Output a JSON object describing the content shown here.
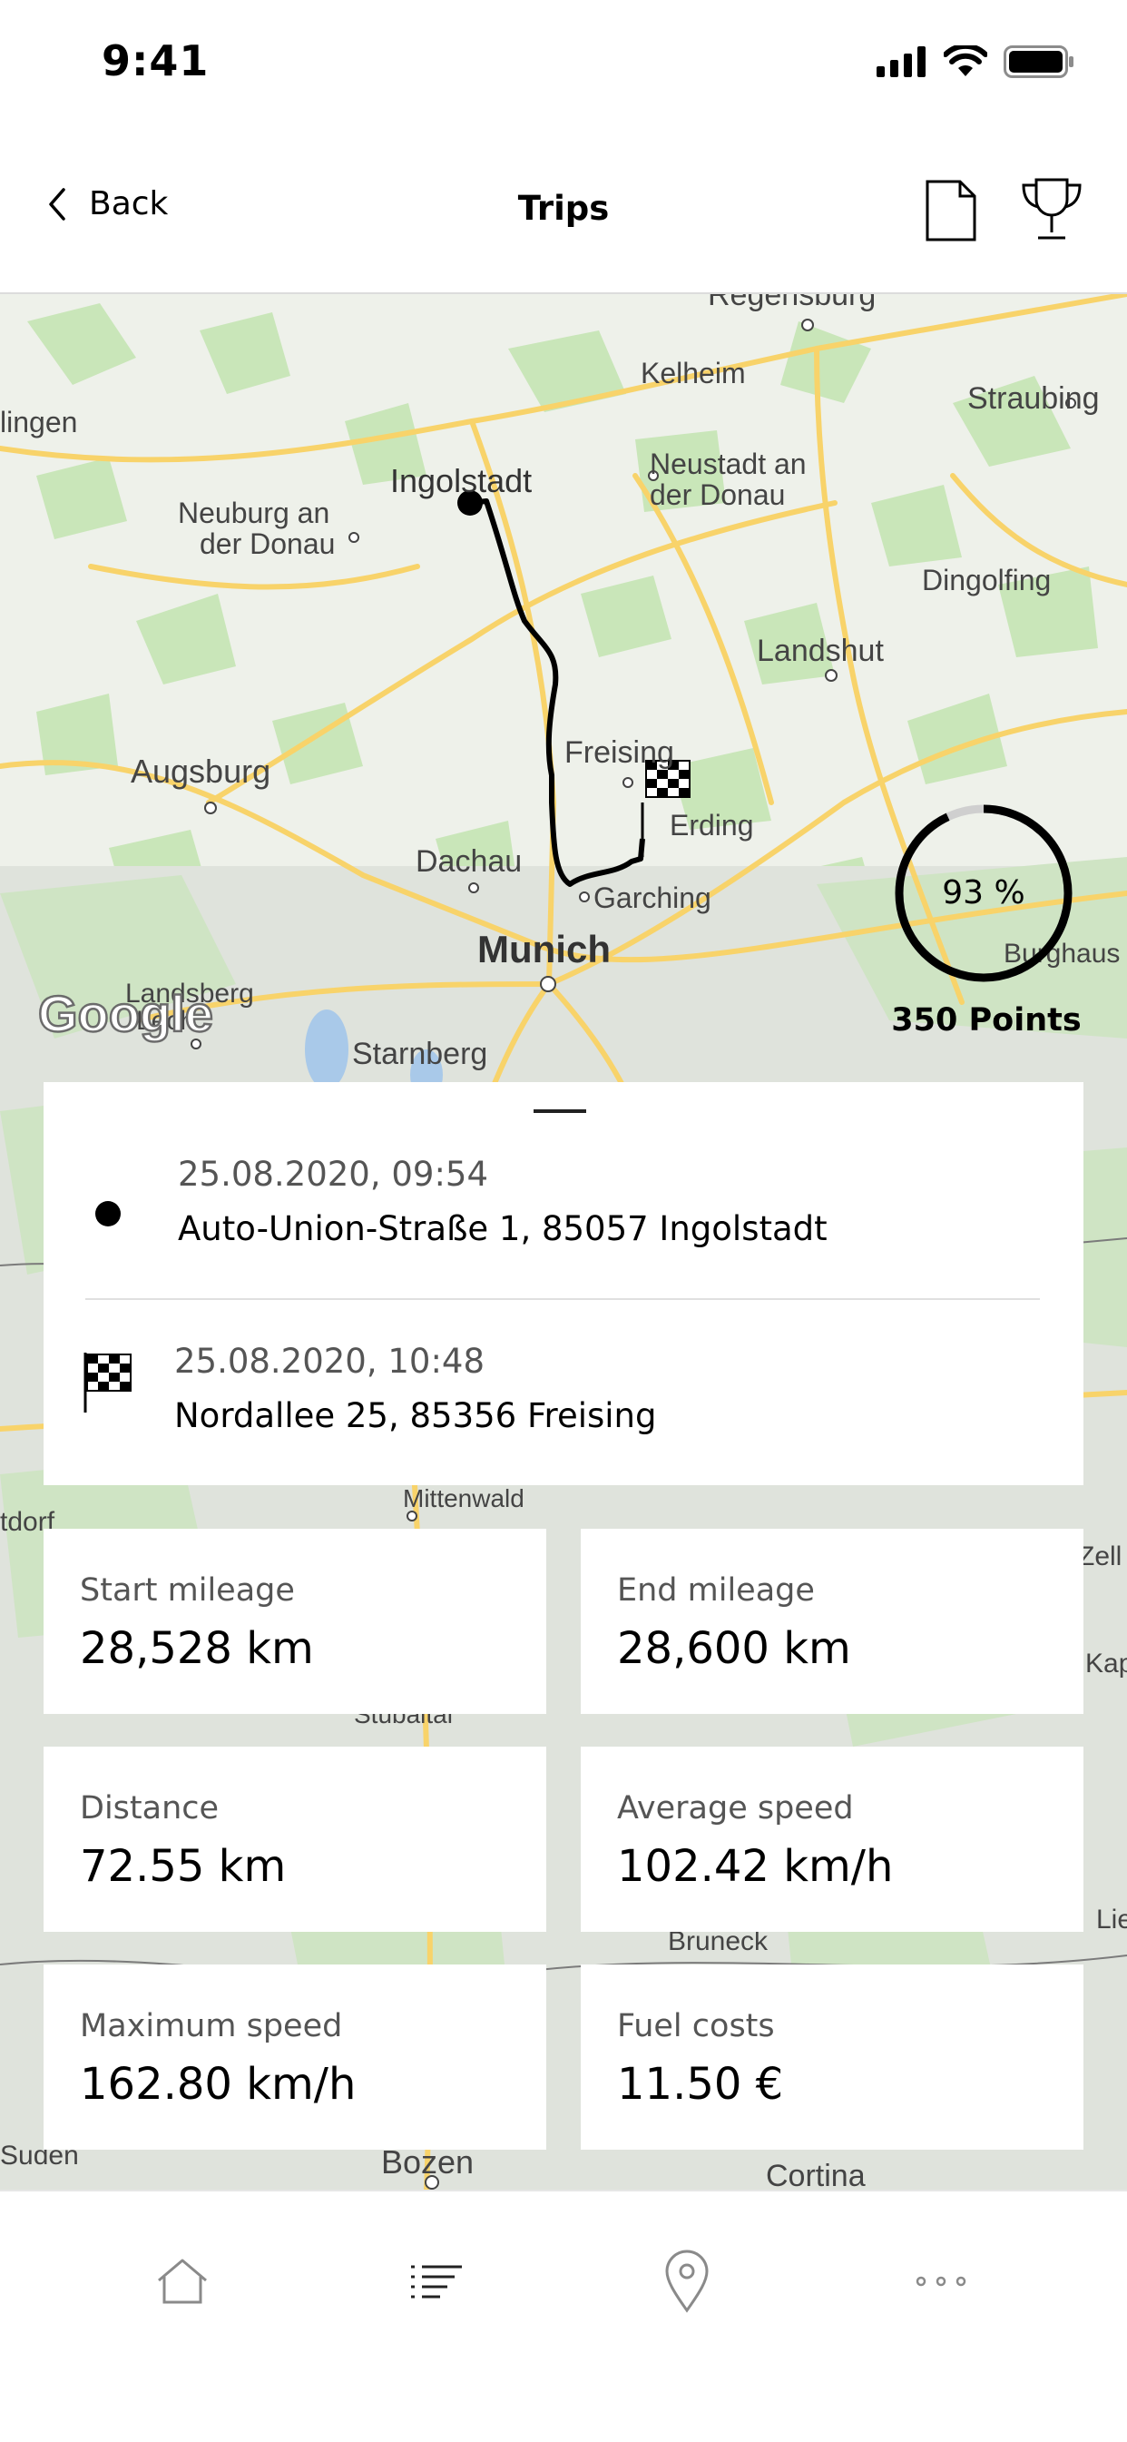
{
  "status_bar": {
    "time": "9:41"
  },
  "nav": {
    "back_label": "Back",
    "title": "Trips"
  },
  "map": {
    "labels": {
      "regensburg": "Regensburg",
      "kelheim": "Kelheim",
      "straubing": "Straubing",
      "ingolstadt": "Ingolstadt",
      "neustadt1": "Neustadt an",
      "neustadt2": "der Donau",
      "neuburg1": "Neuburg an",
      "neuburg2": "der Donau",
      "dingolfing": "Dingolfing",
      "landshut": "Landshut",
      "lingen": "lingen",
      "augsburg": "Augsburg",
      "freising": "Freising",
      "erding": "Erding",
      "dachau": "Dachau",
      "garching": "Garching",
      "munich": "Munich",
      "burghaus": "Burghaus",
      "landsberg1": "Landsberg",
      "landsberg2": "Lech",
      "starnberg": "Starnberg",
      "mittenwald": "Mittenwald",
      "tdorf": "tdorf",
      "stubaital": "Stubaital",
      "bruneck": "Bruneck",
      "bozen": "Bozen",
      "cortina": "Cortina",
      "zell": "Zell",
      "kap": "Kap",
      "lie": "Lie",
      "sudtirol": "Suden"
    },
    "attribution": "Google"
  },
  "score": {
    "percent_text": "93 %",
    "fraction": 0.93,
    "points_text": "350 Points"
  },
  "route": {
    "start": {
      "datetime": "25.08.2020, 09:54",
      "address": "Auto-Union-Straße 1, 85057 Ingolstadt"
    },
    "end": {
      "datetime": "25.08.2020, 10:48",
      "address": "Nordallee 25, 85356 Freising"
    }
  },
  "stats": [
    {
      "label": "Start mileage",
      "value": "28,528 km"
    },
    {
      "label": "End mileage",
      "value": "28,600 km"
    },
    {
      "label": "Distance",
      "value": "72.55 km"
    },
    {
      "label": "Average speed",
      "value": "102.42 km/h"
    },
    {
      "label": "Maximum speed",
      "value": "162.80 km/h"
    },
    {
      "label": "Fuel costs",
      "value": "11.50 €"
    }
  ],
  "colors": {
    "map_bg": "#eef1ea",
    "road": "#f8d36a",
    "forest": "#c9e6b9",
    "route": "#000000",
    "card": "#ffffff"
  },
  "tabs": [
    "home-icon",
    "list-icon",
    "location-pin-icon",
    "more-icon"
  ]
}
